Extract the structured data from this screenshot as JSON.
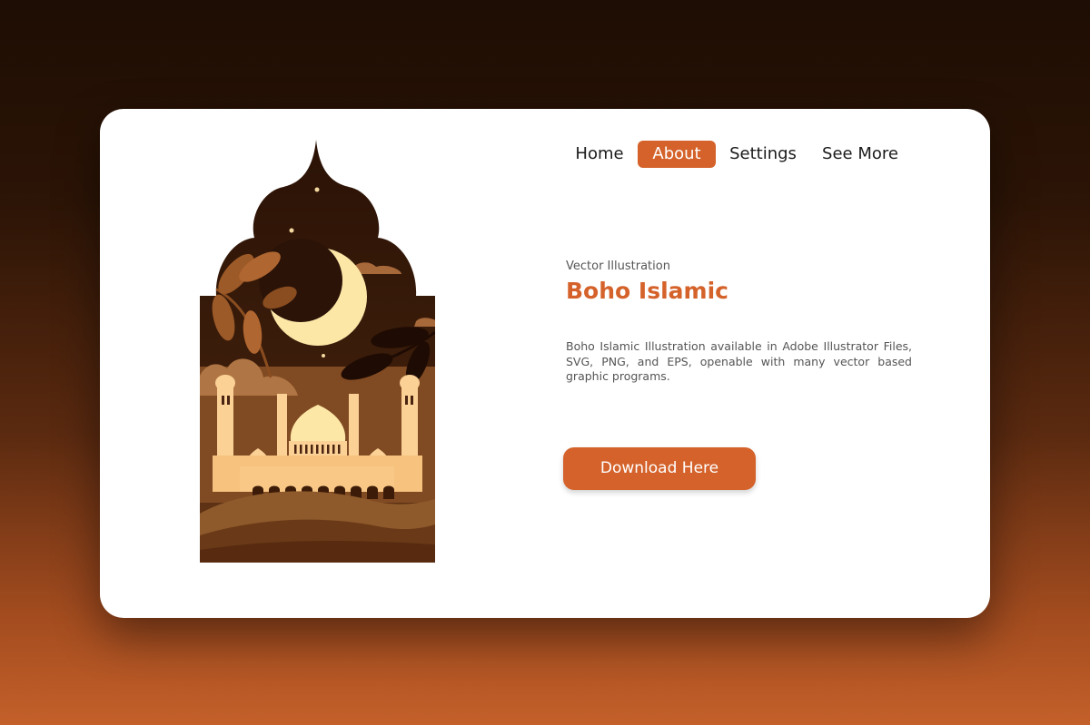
{
  "nav": {
    "items": [
      {
        "label": "Home",
        "active": false
      },
      {
        "label": "About",
        "active": true
      },
      {
        "label": "Settings",
        "active": false
      },
      {
        "label": "See More",
        "active": false
      }
    ]
  },
  "hero": {
    "eyebrow": "Vector Illustration",
    "title": "Boho Islamic",
    "description": "Boho Islamic Illustration available in Adobe Illustrator Files, SVG, PNG, and EPS, openable with many vector based graphic programs.",
    "cta_label": "Download Here"
  },
  "colors": {
    "accent": "#d4622a",
    "night_sky": "#2a1407",
    "moon": "#fde7a7",
    "mosque": "#f6c27e",
    "card": "#ffffff"
  },
  "icons": {
    "illustration": "mosque-night-illustration",
    "moon": "crescent-moon-icon"
  }
}
